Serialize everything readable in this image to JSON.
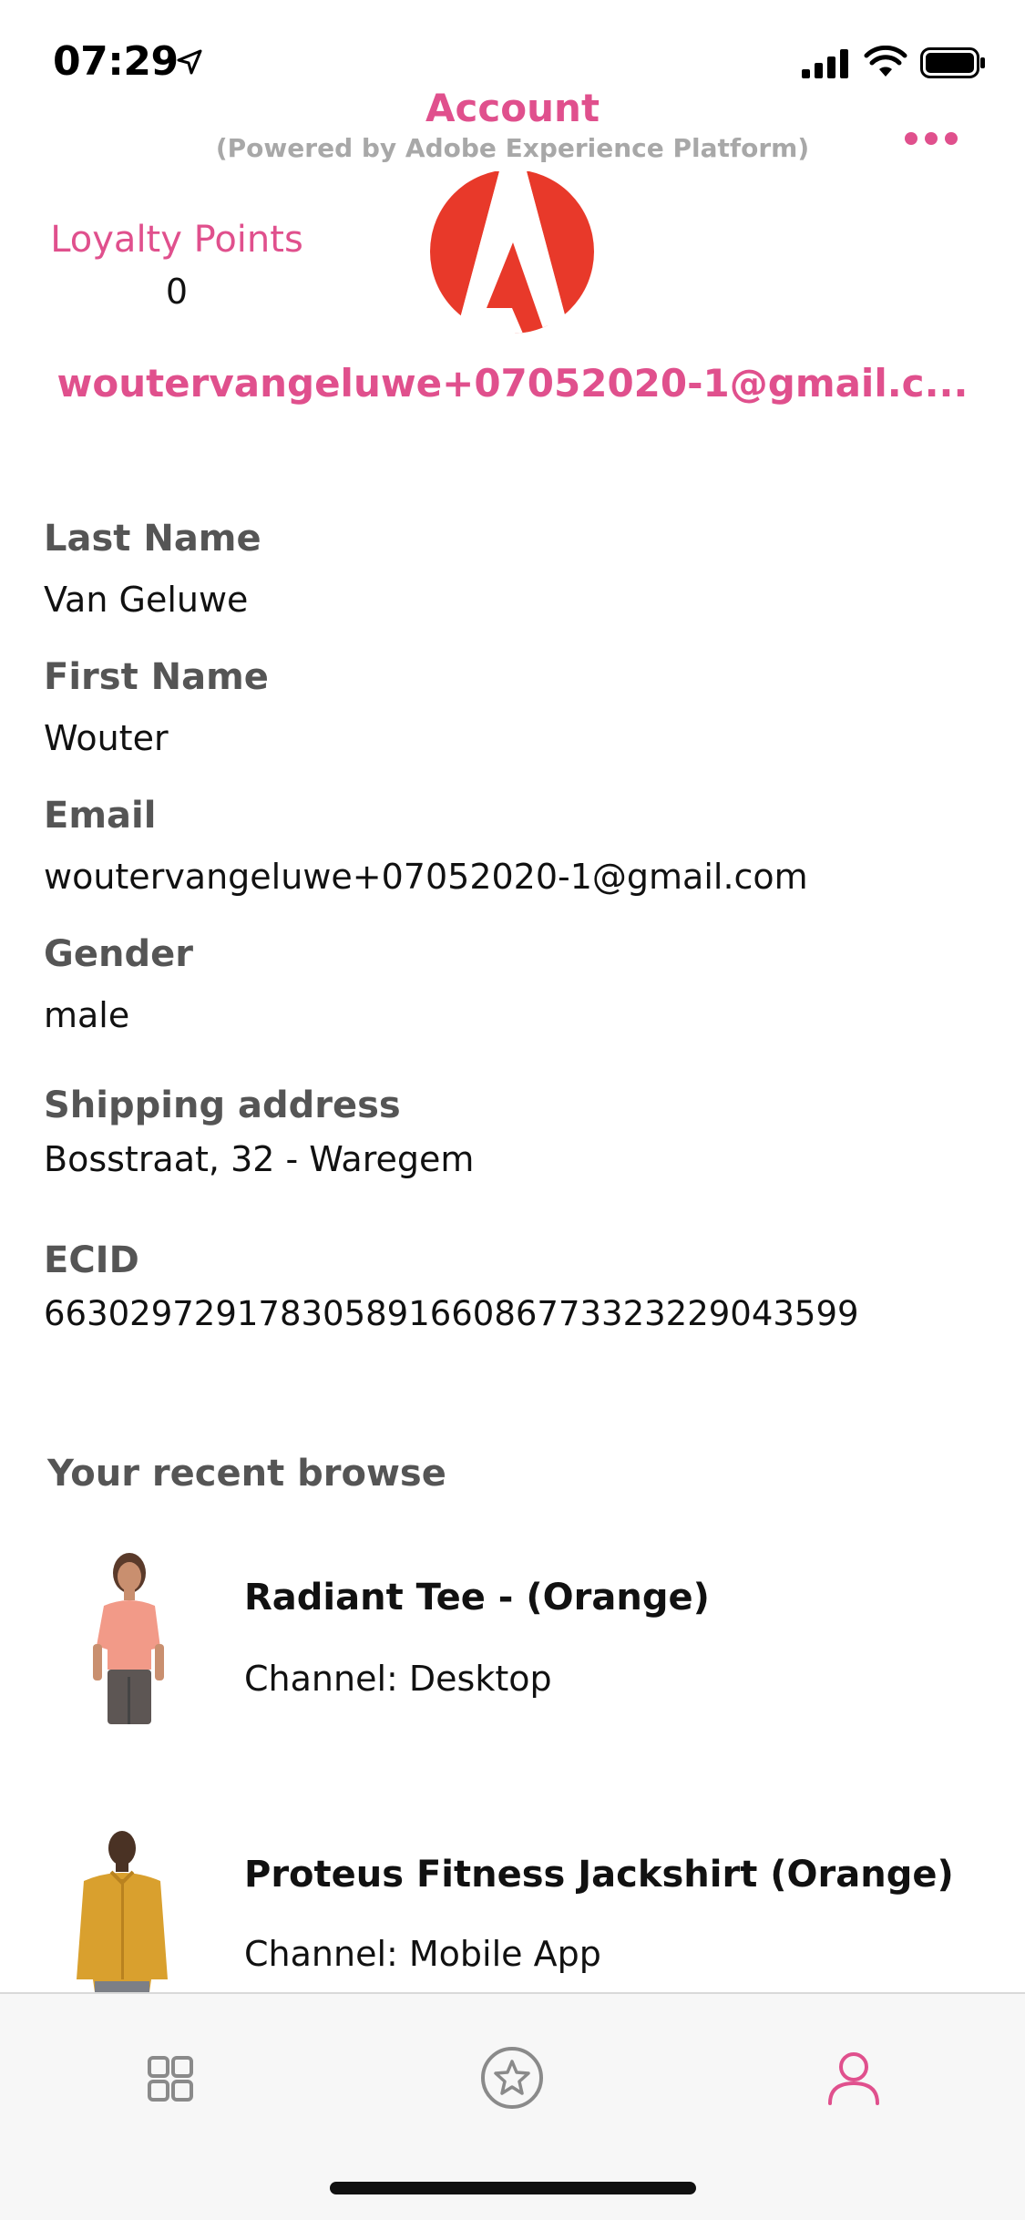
{
  "status_bar": {
    "time": "07:29"
  },
  "header": {
    "title": "Account",
    "subtitle": "(Powered by Adobe Experience Platform)"
  },
  "loyalty": {
    "label": "Loyalty Points",
    "value": "0"
  },
  "account_email": "woutervangeluwe+07052020-1@gmail.c...",
  "profile": {
    "fields": [
      {
        "label": "Last Name",
        "value": "Van Geluwe"
      },
      {
        "label": "First Name",
        "value": "Wouter"
      },
      {
        "label": "Email",
        "value": "woutervangeluwe+07052020-1@gmail.com"
      },
      {
        "label": "Gender",
        "value": "male"
      },
      {
        "label": "Shipping address",
        "value": "Bosstraat, 32 - Waregem"
      },
      {
        "label": "ECID",
        "value": "66302972917830589166086773323229043599"
      }
    ]
  },
  "recent": {
    "title": "Your recent browse",
    "items": [
      {
        "name": "Radiant Tee - (Orange)",
        "channel": "Channel: Desktop"
      },
      {
        "name": "Proteus Fitness Jackshirt (Orange)",
        "channel": "Channel: Mobile App"
      }
    ]
  },
  "colors": {
    "accent": "#e0508d",
    "subtitle_gray": "#a8a8a8",
    "label_gray": "#555555",
    "logo_red": "#e8392a"
  },
  "tabs": [
    {
      "icon": "grid-icon"
    },
    {
      "icon": "star-circle-icon"
    },
    {
      "icon": "user-icon",
      "active": true
    }
  ]
}
